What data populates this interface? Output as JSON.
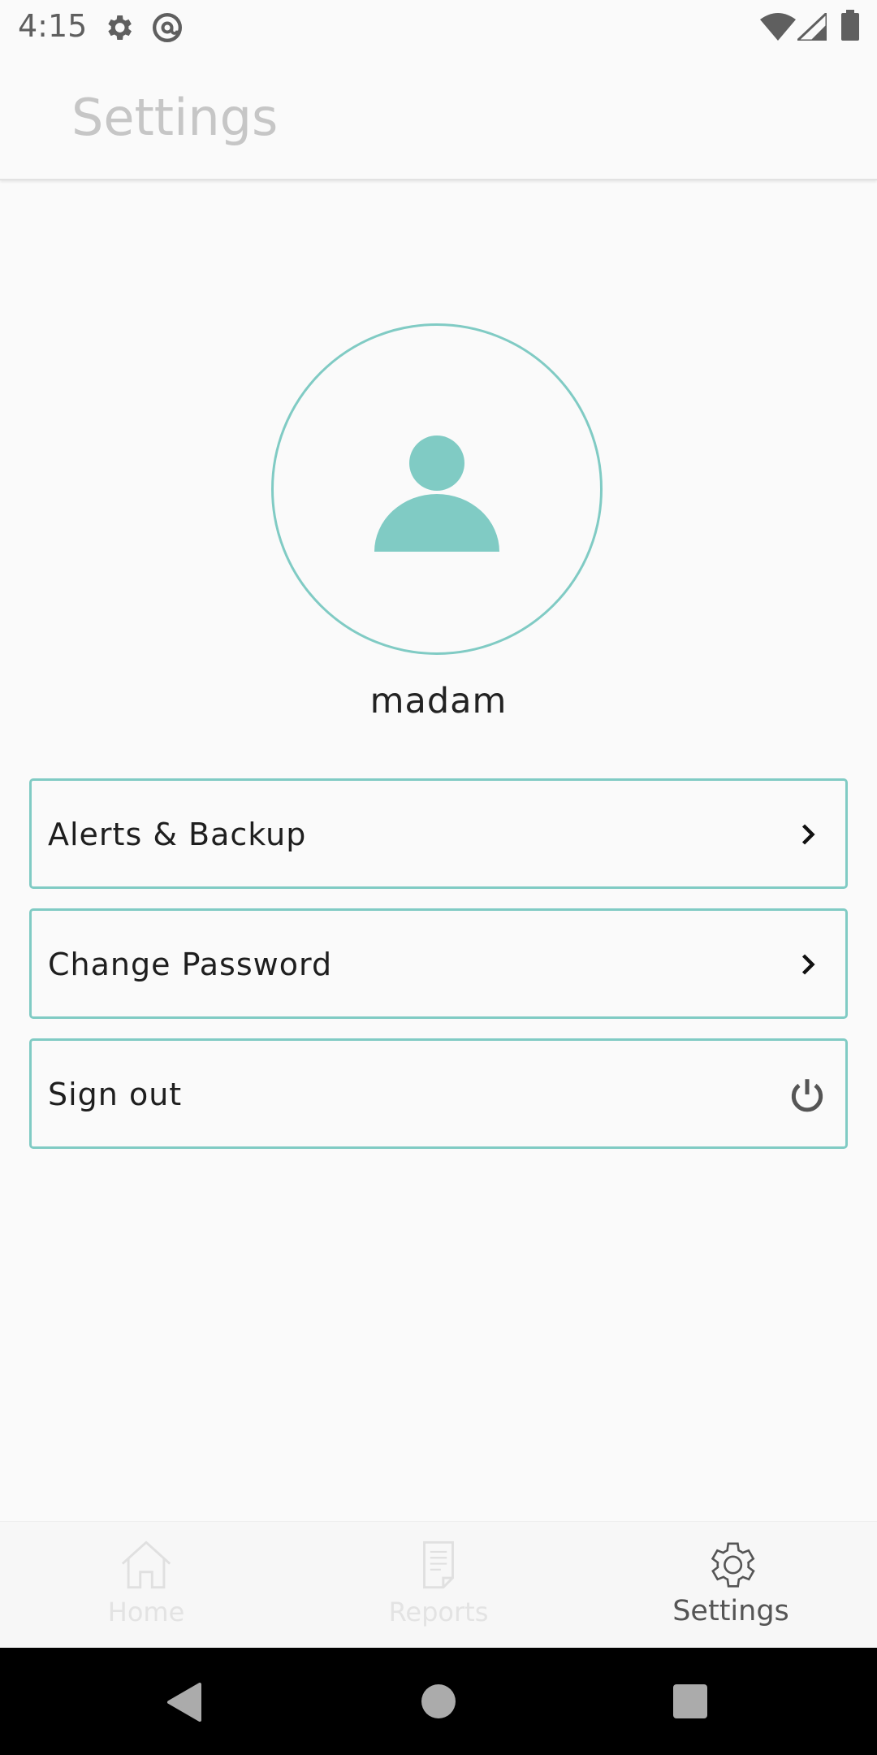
{
  "status_bar": {
    "time": "4:15",
    "icons": [
      "gear-icon",
      "at-sign-icon",
      "wifi-icon",
      "signal-icon",
      "battery-icon"
    ]
  },
  "app_bar": {
    "title": "Settings"
  },
  "profile": {
    "username": "madam",
    "avatar_icon": "person-icon"
  },
  "menu": {
    "items": [
      {
        "label": "Alerts & Backup",
        "icon": "chevron-right-icon"
      },
      {
        "label": "Change Password",
        "icon": "chevron-right-icon"
      },
      {
        "label": "Sign out",
        "icon": "power-icon"
      }
    ]
  },
  "bottom_nav": {
    "items": [
      {
        "label": "Home",
        "icon": "home-icon",
        "active": false
      },
      {
        "label": "Reports",
        "icon": "document-icon",
        "active": false
      },
      {
        "label": "Settings",
        "icon": "gear-icon",
        "active": true
      }
    ]
  },
  "system_nav": {
    "buttons": [
      "back-icon",
      "home-circle-icon",
      "recents-square-icon"
    ]
  },
  "colors": {
    "accent": "#80cbc4",
    "title_text": "#c6c6c6",
    "background": "#fafafa"
  }
}
